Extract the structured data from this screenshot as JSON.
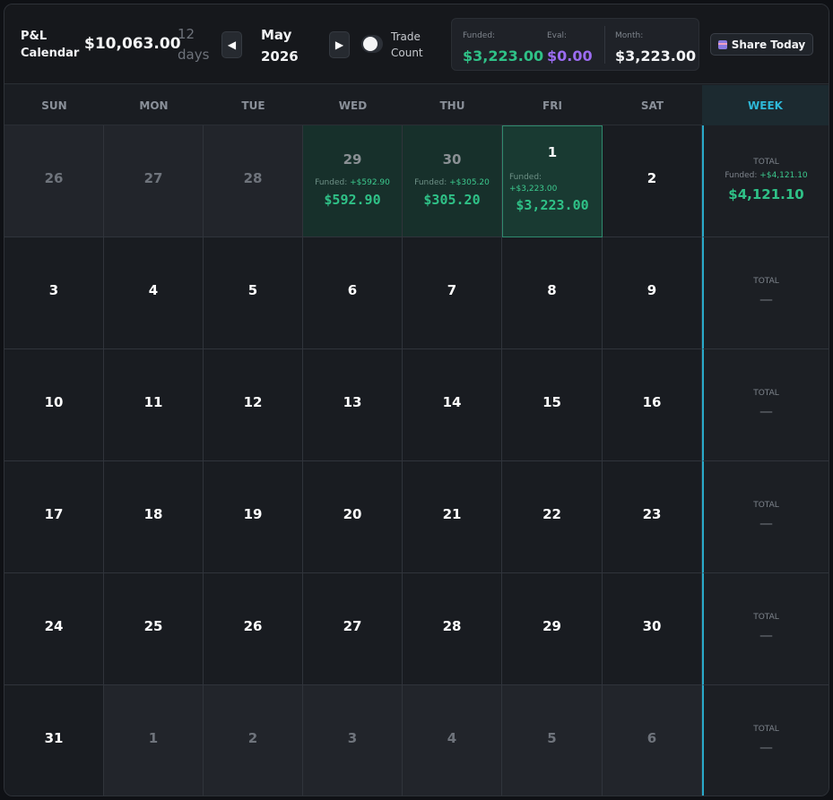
{
  "header": {
    "title_line1": "P&L",
    "title_line2": "Calendar",
    "total": "$10,063.00",
    "days_num": "12",
    "days_label": "days",
    "prev_icon": "◀",
    "next_icon": "▶",
    "month": "May",
    "year": "2026",
    "toggle_label_line1": "Trade",
    "toggle_label_line2": "Count",
    "toggle_on": false,
    "stats": [
      {
        "label": "Funded:",
        "value": "$3,223.00",
        "color": "#2fc187"
      },
      {
        "label": "Eval:",
        "value": "$0.00",
        "color": "#9b6cf0"
      },
      {
        "label": "Month:",
        "value": "$3,223.00",
        "color": "#f2f3f5"
      }
    ],
    "share_label": "Share Today",
    "share_icon": "gift-icon"
  },
  "weekdays": [
    "SUN",
    "MON",
    "TUE",
    "WED",
    "THU",
    "FRI",
    "SAT",
    "WEEK"
  ],
  "weeks": [
    {
      "days": [
        {
          "num": "26",
          "type": "other"
        },
        {
          "num": "27",
          "type": "other"
        },
        {
          "num": "28",
          "type": "other"
        },
        {
          "num": "29",
          "type": "profit",
          "funded_label": "Funded: ",
          "funded_value": "+$592.90",
          "amount": "$592.90"
        },
        {
          "num": "30",
          "type": "profit",
          "funded_label": "Funded: ",
          "funded_value": "+$305.20",
          "amount": "$305.20"
        },
        {
          "num": "1",
          "type": "today",
          "funded_label": "Funded:",
          "funded_value": "+$3,223.00",
          "amount": "$3,223.00"
        },
        {
          "num": "2",
          "type": "current"
        }
      ],
      "total_label": "TOTAL",
      "funded_label": "Funded: ",
      "funded_value": "+$4,121.10",
      "total_value": "$4,121.10"
    },
    {
      "days": [
        {
          "num": "3",
          "type": "current"
        },
        {
          "num": "4",
          "type": "current"
        },
        {
          "num": "5",
          "type": "current"
        },
        {
          "num": "6",
          "type": "current"
        },
        {
          "num": "7",
          "type": "current"
        },
        {
          "num": "8",
          "type": "current"
        },
        {
          "num": "9",
          "type": "current"
        }
      ],
      "total_label": "TOTAL",
      "total_value": "—"
    },
    {
      "days": [
        {
          "num": "10",
          "type": "current"
        },
        {
          "num": "11",
          "type": "current"
        },
        {
          "num": "12",
          "type": "current"
        },
        {
          "num": "13",
          "type": "current"
        },
        {
          "num": "14",
          "type": "current"
        },
        {
          "num": "15",
          "type": "current"
        },
        {
          "num": "16",
          "type": "current"
        }
      ],
      "total_label": "TOTAL",
      "total_value": "—"
    },
    {
      "days": [
        {
          "num": "17",
          "type": "current"
        },
        {
          "num": "18",
          "type": "current"
        },
        {
          "num": "19",
          "type": "current"
        },
        {
          "num": "20",
          "type": "current"
        },
        {
          "num": "21",
          "type": "current"
        },
        {
          "num": "22",
          "type": "current"
        },
        {
          "num": "23",
          "type": "current"
        }
      ],
      "total_label": "TOTAL",
      "total_value": "—"
    },
    {
      "days": [
        {
          "num": "24",
          "type": "current"
        },
        {
          "num": "25",
          "type": "current"
        },
        {
          "num": "26",
          "type": "current"
        },
        {
          "num": "27",
          "type": "current"
        },
        {
          "num": "28",
          "type": "current"
        },
        {
          "num": "29",
          "type": "current"
        },
        {
          "num": "30",
          "type": "current"
        }
      ],
      "total_label": "TOTAL",
      "total_value": "—"
    },
    {
      "days": [
        {
          "num": "31",
          "type": "current"
        },
        {
          "num": "1",
          "type": "other"
        },
        {
          "num": "2",
          "type": "other"
        },
        {
          "num": "3",
          "type": "other"
        },
        {
          "num": "4",
          "type": "other"
        },
        {
          "num": "5",
          "type": "other"
        },
        {
          "num": "6",
          "type": "other"
        }
      ],
      "total_label": "TOTAL",
      "total_value": "—"
    }
  ]
}
